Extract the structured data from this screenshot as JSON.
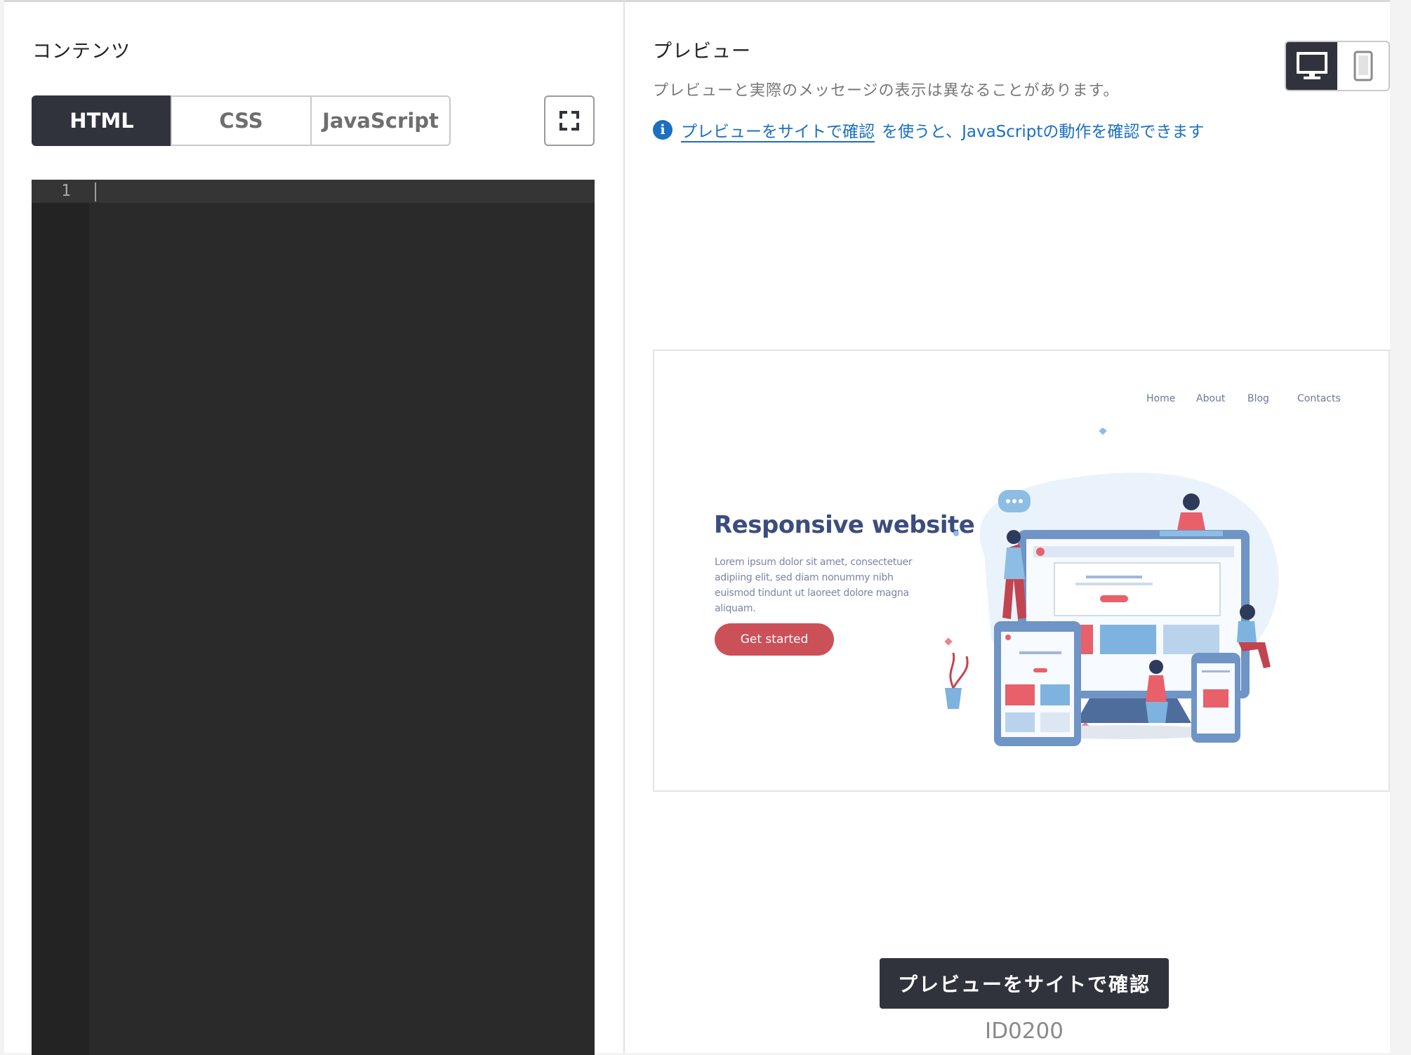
{
  "content": {
    "title": "コンテンツ",
    "tabs": [
      {
        "label": "HTML",
        "active": true
      },
      {
        "label": "CSS",
        "active": false
      },
      {
        "label": "JavaScript",
        "active": false
      }
    ],
    "fullscreen_icon": "expand-icon",
    "editor": {
      "line_numbers": [
        "1"
      ],
      "code": ""
    }
  },
  "preview": {
    "title": "プレビュー",
    "note": "プレビューと実際のメッセージの表示は異なることがあります。",
    "info_link": "プレビューをサイトで確認",
    "info_rest": "を使うと、JavaScriptの動作を確認できます",
    "device_toggle": [
      {
        "icon": "desktop-icon",
        "active": true
      },
      {
        "icon": "mobile-icon",
        "active": false
      }
    ],
    "sample": {
      "nav": [
        "Home",
        "About",
        "Blog",
        "Contacts"
      ],
      "title": "Responsive website",
      "body": "Lorem ipsum dolor sit amet, consectetuer adipiing elit, sed diam nonummy nibh euismod tindunt ut laoreet dolore magna aliquam.",
      "button": "Get started"
    },
    "check_button": "プレビューをサイトで確認",
    "id": "ID0200"
  },
  "colors": {
    "dark": "#30333b",
    "link": "#1b6fc2",
    "editor_bg": "#2a2a2b",
    "accent_red": "#cb5058",
    "heading_blue": "#3b4d7e"
  }
}
